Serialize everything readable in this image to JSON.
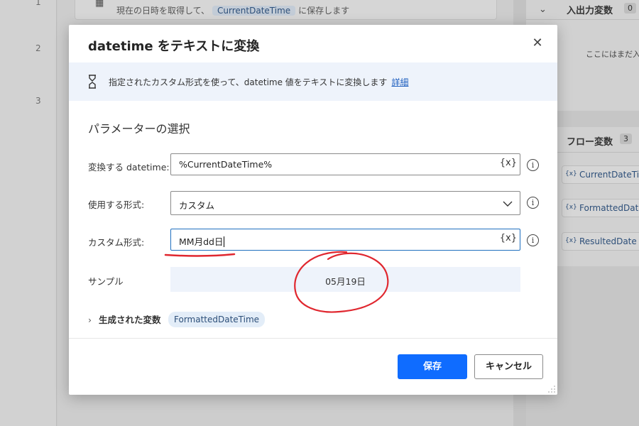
{
  "background": {
    "line_numbers": [
      "1",
      "2",
      "3"
    ],
    "step": {
      "text_before": "現在の日時を取得して、",
      "variable": "CurrentDateTime",
      "text_after": "に保存します"
    },
    "io_panel": {
      "title": "入出力変数",
      "count": "0",
      "empty_text": "ここにはまだ入"
    },
    "flow_panel": {
      "title": "フロー変数",
      "count": "3",
      "variables": [
        "CurrentDateTi...",
        "FormattedDat...",
        "ResultedDate"
      ]
    }
  },
  "dialog": {
    "title": "datetime をテキストに変換",
    "info_text": "指定されたカスタム形式を使って、datetime 値をテキストに変換します",
    "info_link": "詳細",
    "section_title": "パラメーターの選択",
    "fields": {
      "datetime": {
        "label": "変換する datetime:",
        "value": "%CurrentDateTime%",
        "var_button": "{x}",
        "info": "i"
      },
      "format": {
        "label": "使用する形式:",
        "value": "カスタム",
        "info": "i"
      },
      "custom": {
        "label": "カスタム形式:",
        "value": "MM月dd日",
        "var_button": "{x}",
        "info": "i"
      },
      "sample": {
        "label": "サンプル",
        "value": "05月19日"
      }
    },
    "generated": {
      "label": "生成された変数",
      "chevron": "›",
      "variable": "FormattedDateTime"
    },
    "buttons": {
      "save": "保存",
      "cancel": "キャンセル"
    },
    "close_glyph": "✕"
  },
  "colors": {
    "primary": "#0f6cff",
    "annotation": "#e0272f",
    "info_bar": "#eef3fb"
  }
}
